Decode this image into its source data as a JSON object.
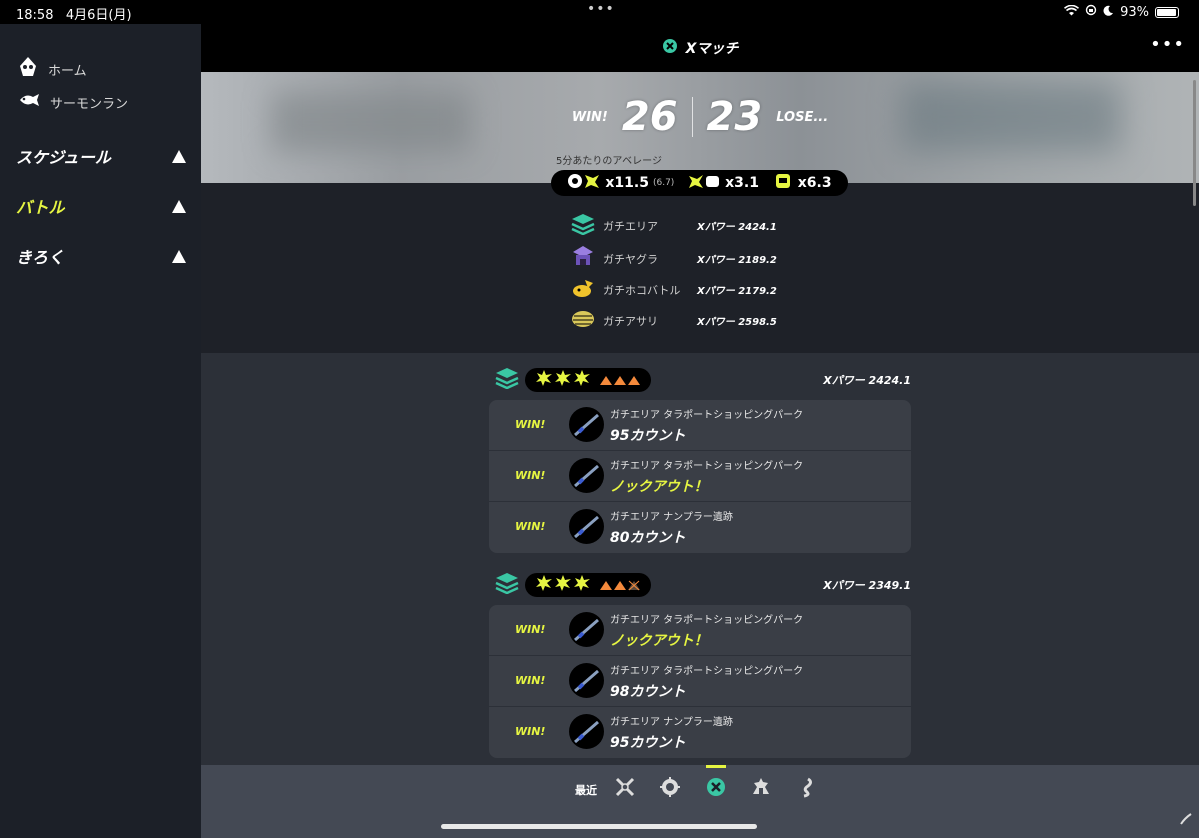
{
  "status": {
    "time": "18:58",
    "date": "4月6日(月)",
    "battery": "93%",
    "battery_level": 0.93
  },
  "header": {
    "title": "Xマッチ"
  },
  "sidebar": {
    "links": [
      {
        "label": "ホーム",
        "icon": "squid-icon"
      },
      {
        "label": "サーモンラン",
        "icon": "salmon-icon"
      }
    ],
    "sections": [
      {
        "label": "スケジュール",
        "color": "#ffffff"
      },
      {
        "label": "バトル",
        "color": "#e6f542"
      },
      {
        "label": "きろく",
        "color": "#ffffff"
      }
    ]
  },
  "summary": {
    "win_label": "WIN!",
    "lose_label": "LOSE...",
    "wins": "26",
    "losses": "23",
    "average_label": "5分あたりのアベレージ",
    "kills": "x11.5",
    "kills_sub": "(6.7)",
    "specials": "x3.1",
    "paint": "x6.3"
  },
  "powers": [
    {
      "mode": "ガチエリア",
      "value": "Xパワー 2424.1",
      "icon": "splat-zones-icon"
    },
    {
      "mode": "ガチヤグラ",
      "value": "Xパワー 2189.2",
      "icon": "tower-control-icon"
    },
    {
      "mode": "ガチホコバトル",
      "value": "Xパワー 2179.2",
      "icon": "rainmaker-icon"
    },
    {
      "mode": "ガチアサリ",
      "value": "Xパワー 2598.5",
      "icon": "clam-blitz-icon"
    }
  ],
  "groups": [
    {
      "xpower": "Xパワー 2424.1",
      "matches": [
        {
          "result": "WIN!",
          "stage": "ガチエリア タラポートショッピングパーク",
          "score": "95カウント",
          "ko": false
        },
        {
          "result": "WIN!",
          "stage": "ガチエリア タラポートショッピングパーク",
          "score": "ノックアウト！",
          "ko": true
        },
        {
          "result": "WIN!",
          "stage": "ガチエリア ナンプラー遺跡",
          "score": "80カウント",
          "ko": false
        }
      ]
    },
    {
      "xpower": "Xパワー 2349.1",
      "matches": [
        {
          "result": "WIN!",
          "stage": "ガチエリア タラポートショッピングパーク",
          "score": "ノックアウト！",
          "ko": true
        },
        {
          "result": "WIN!",
          "stage": "ガチエリア タラポートショッピングパーク",
          "score": "98カウント",
          "ko": false
        },
        {
          "result": "WIN!",
          "stage": "ガチエリア ナンプラー遺跡",
          "score": "95カウント",
          "ko": false
        }
      ]
    }
  ],
  "tabs": {
    "recent_label": "最近"
  },
  "colors": {
    "accent": "#e6f542",
    "zones": "#3ac7a4",
    "arrow": "#f48a3c"
  }
}
